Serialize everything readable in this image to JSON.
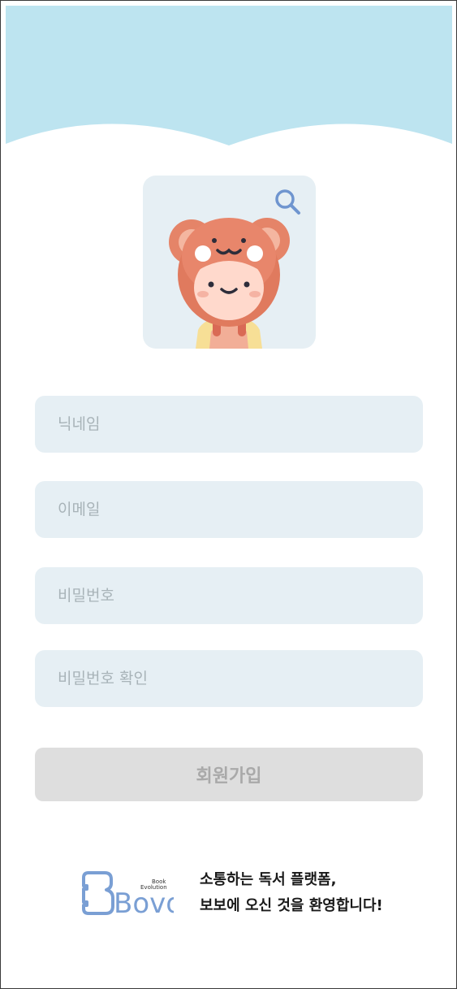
{
  "header": {
    "wave_color": "#bde4f0"
  },
  "avatar": {
    "search_icon": "search-icon",
    "character": "bear-costume-kid"
  },
  "form": {
    "nickname_placeholder": "닉네임",
    "email_placeholder": "이메일",
    "password_placeholder": "비밀번호",
    "password_confirm_placeholder": "비밀번호 확인",
    "submit_label": "회원가입"
  },
  "footer": {
    "logo_text": "Bovo",
    "logo_sub_1": "Book",
    "logo_sub_2": "Evolution",
    "message_line1": "소통하는 독서 플랫폼,",
    "message_line2": "보보에 오신 것을 환영합니다!"
  },
  "colors": {
    "field_bg": "#e6eff4",
    "button_bg": "#dedede",
    "brand_blue": "#7a9fd4"
  }
}
